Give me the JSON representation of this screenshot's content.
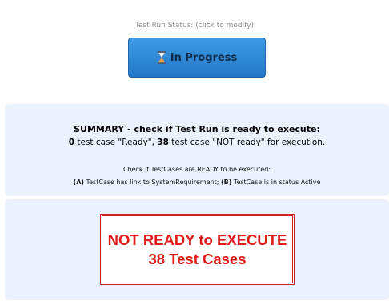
{
  "status": {
    "caption": "Test Run Status: (click to modify)",
    "button_label": "In Progress",
    "button_icon": "hourglass-icon"
  },
  "summary": {
    "title": "SUMMARY - check if Test Run is ready to execute:",
    "ready_count": "0",
    "ready_text": " test case \"Ready\", ",
    "not_ready_count": "38",
    "not_ready_text": " test case \"NOT ready\" for execution.",
    "check_title": "Check if TestCases are READY to be executed:",
    "criterion_a_label": "(A)",
    "criterion_a_text": " TestCase has link to SystemRequirement; ",
    "criterion_b_label": "(B)",
    "criterion_b_text": " TestCase is in status Active"
  },
  "readiness": {
    "status_text": "NOT READY to EXECUTE",
    "count_text": "38 Test Cases",
    "color": "#e11a1a"
  }
}
